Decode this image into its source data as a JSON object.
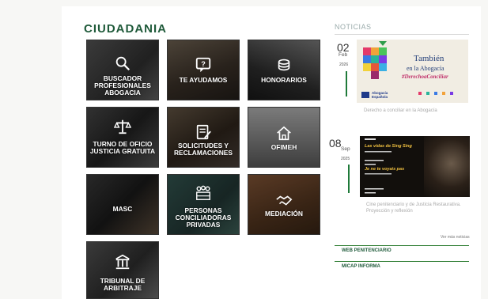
{
  "section_title": "CIUDADANIA",
  "tiles": [
    {
      "label": "BUSCADOR PROFESIONALES ABOGACIA",
      "icon": "search-icon"
    },
    {
      "label": "TE AYUDAMOS",
      "icon": "help-icon"
    },
    {
      "label": "HONORARIOS",
      "icon": "coins-icon"
    },
    {
      "label": "TURNO DE OFICIO JUSTICIA GRATUITA",
      "icon": "scales-icon"
    },
    {
      "label": "SOLICITUDES Y RECLAMACIONES",
      "icon": "form-icon"
    },
    {
      "label": "OFIMEH",
      "icon": "home-icon"
    },
    {
      "label": "MASC",
      "icon": "people-icon"
    },
    {
      "label": "PERSONAS CONCILIADORAS PRIVADAS",
      "icon": "group-icon"
    },
    {
      "label": "MEDIACIÓN",
      "icon": "handshake-icon"
    },
    {
      "label": "TRIBUNAL DE ARBITRAJE",
      "icon": "building-icon"
    }
  ],
  "news": {
    "heading": "NOTICIAS",
    "items": [
      {
        "day": "02",
        "month": "Feb",
        "year": "2026",
        "image_text": {
          "title": "También",
          "subtitle": "en la Abogacía",
          "hashtag": "#DerechoaConciliar",
          "brand": "Abogacía Española"
        },
        "caption": "Derecho a conciliar en la Abogacía"
      },
      {
        "day": "08",
        "month": "Sep",
        "year": "2025",
        "image_text": {
          "l1": "Las vidas de Sing Sing",
          "l2": "Je ne te voyais pas"
        },
        "caption": "Cine penitenciario y de Justicia Restaurativa. Proyección y reflexión"
      }
    ],
    "more_label": "Ver más noticias"
  },
  "links": [
    "WEB PENITENCIARIO",
    "MICAP INFORMA"
  ],
  "colors": {
    "brand_green": "#1f5a3a",
    "accent_green": "#2e7d32"
  }
}
